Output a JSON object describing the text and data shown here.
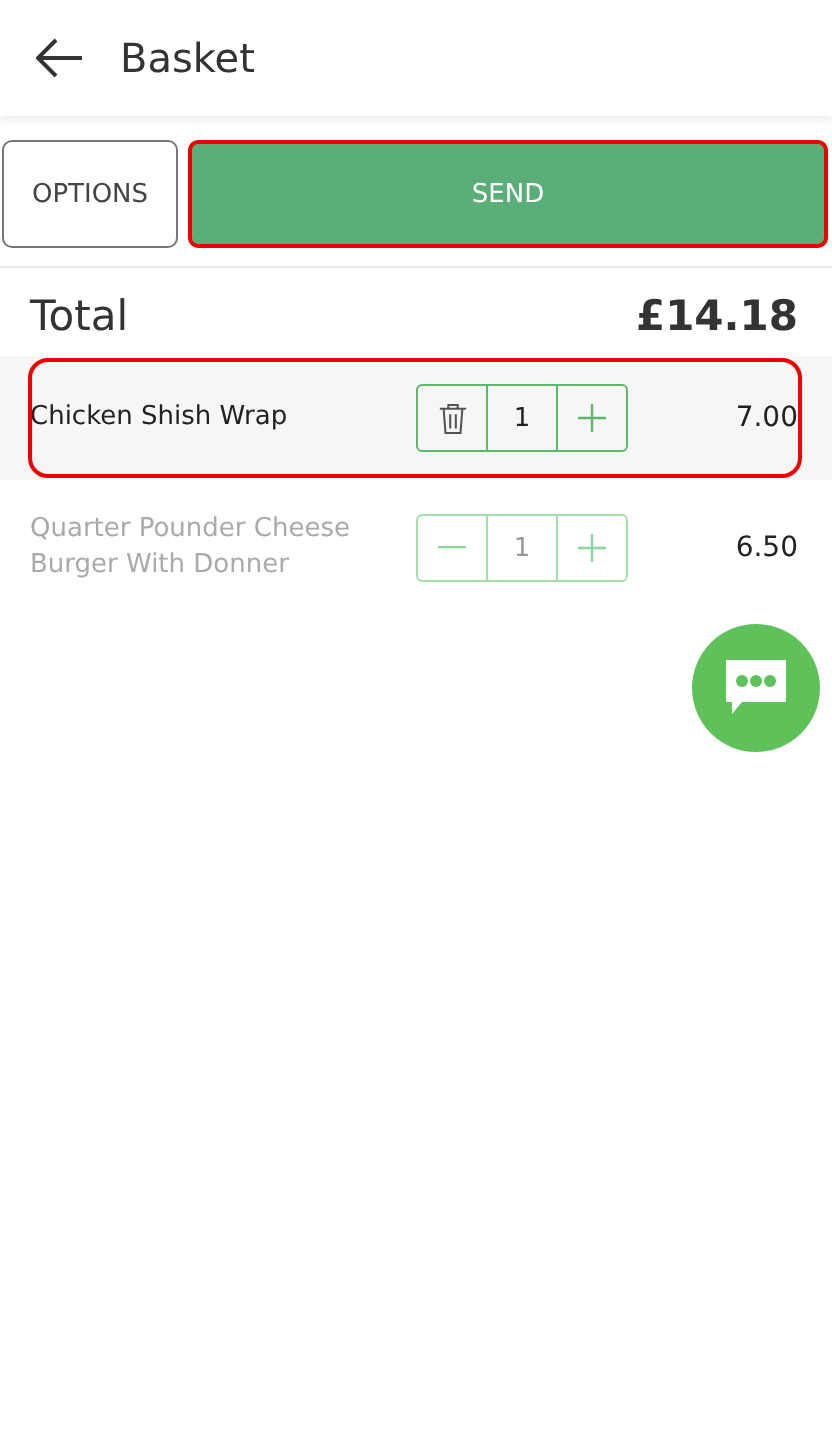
{
  "header": {
    "title": "Basket"
  },
  "actions": [
    {
      "kind": "outline",
      "label": "OPTIONS",
      "highlighted": false
    },
    {
      "kind": "primary",
      "label": "SEND",
      "highlighted": true
    }
  ],
  "total": {
    "label": "Total",
    "amount": "£14.18"
  },
  "items": [
    {
      "name": "Chicken Shish Wrap",
      "quantity": "1",
      "price": "7.00",
      "selected": true,
      "highlighted": true
    },
    {
      "name": "Quarter Pounder Cheese Burger With Donner",
      "quantity": "1",
      "price": "6.50",
      "selected": false,
      "highlighted": false
    }
  ]
}
